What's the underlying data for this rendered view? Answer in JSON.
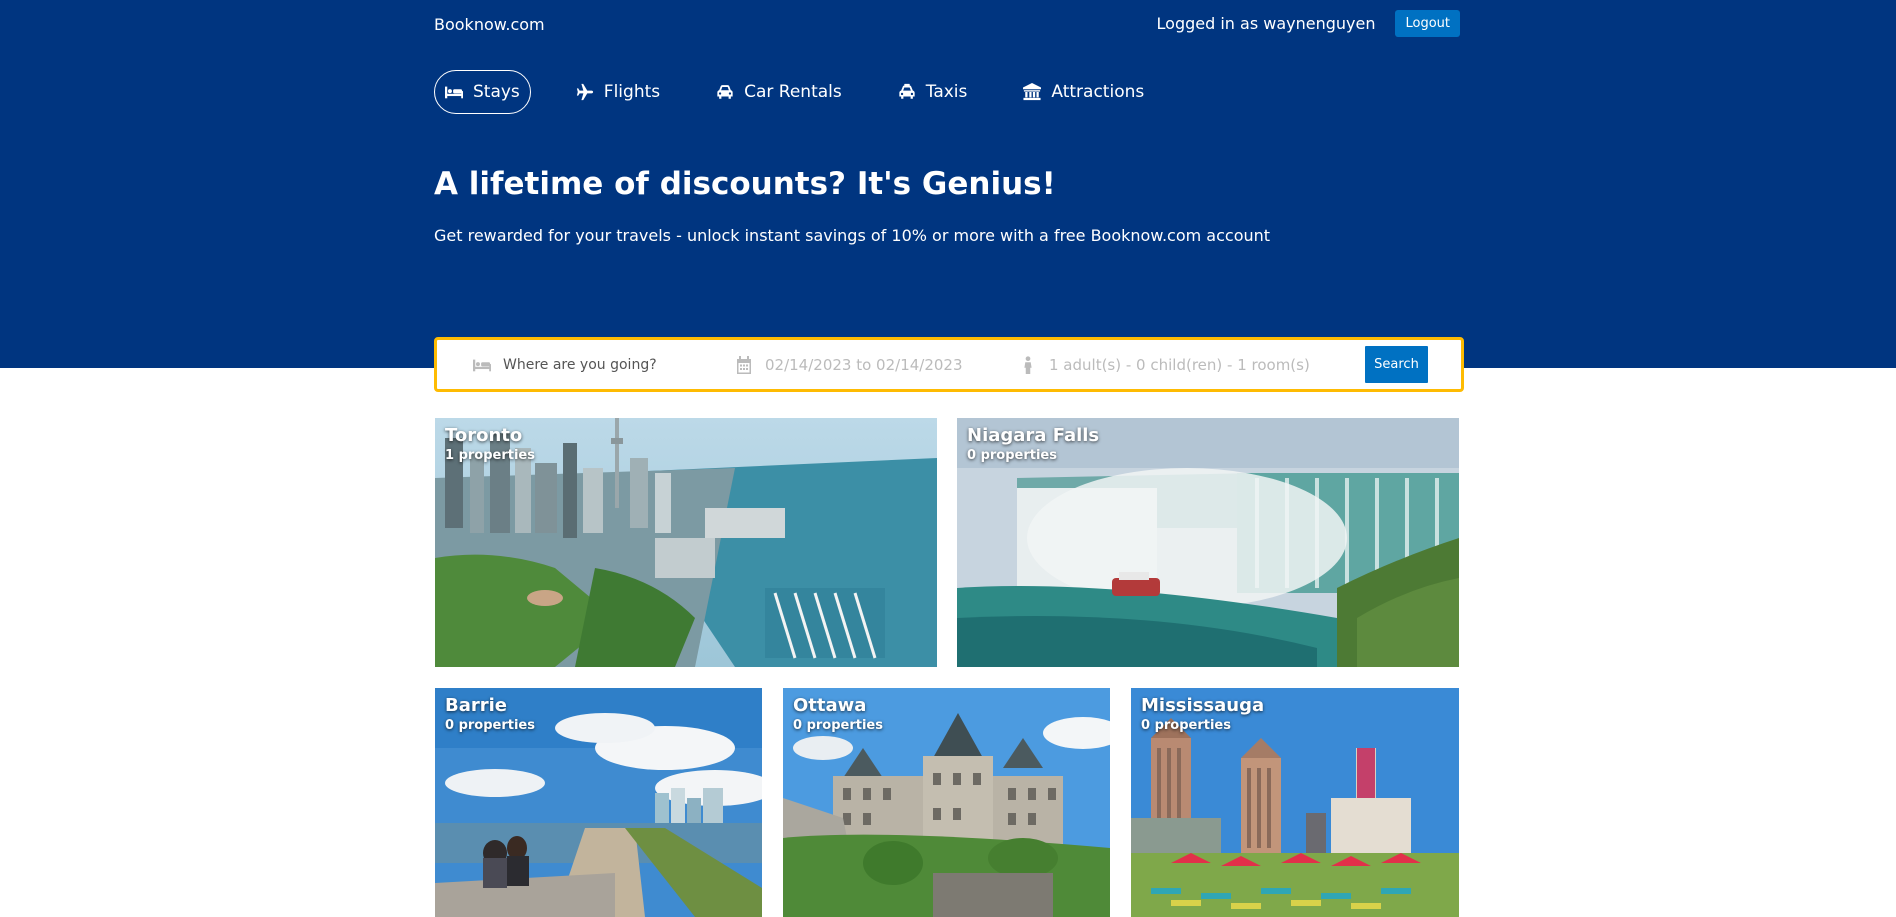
{
  "header": {
    "logo": "Booknow.com",
    "user_text": "Logged in as waynenguyen",
    "logout_label": "Logout"
  },
  "nav": {
    "items": [
      {
        "label": "Stays",
        "icon": "bed-icon",
        "active": true
      },
      {
        "label": "Flights",
        "icon": "plane-icon"
      },
      {
        "label": "Car Rentals",
        "icon": "car-icon"
      },
      {
        "label": "Taxis",
        "icon": "taxi-icon"
      },
      {
        "label": "Attractions",
        "icon": "museum-icon"
      }
    ]
  },
  "hero": {
    "title": "A lifetime of discounts? It's Genius!",
    "subtitle": "Get rewarded for your travels - unlock instant savings of 10% or more with a free Booknow.com account"
  },
  "search": {
    "destination_placeholder": "Where are you going?",
    "dates": "02/14/2023 to 02/14/2023",
    "occupancy": "1 adult(s) - 0 child(ren) - 1 room(s)",
    "button_label": "Search"
  },
  "destinations": [
    {
      "name": "Toronto",
      "count": "1 properties"
    },
    {
      "name": "Niagara Falls",
      "count": "0 properties"
    },
    {
      "name": "Barrie",
      "count": "0 properties"
    },
    {
      "name": "Ottawa",
      "count": "0 properties"
    },
    {
      "name": "Mississauga",
      "count": "0 properties"
    }
  ],
  "colors": {
    "brand": "#003580",
    "accent": "#0071c2",
    "search_border": "#febb02"
  }
}
